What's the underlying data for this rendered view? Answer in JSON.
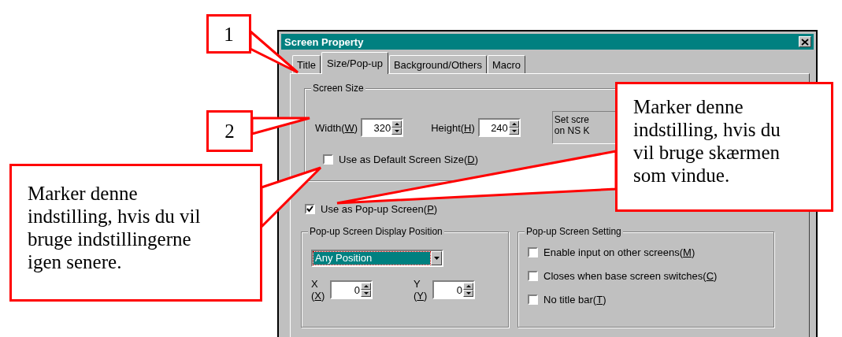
{
  "dialog": {
    "title": "Screen Property"
  },
  "tabs": [
    {
      "label": "Title",
      "selected": false
    },
    {
      "label": "Size/Pop-up",
      "selected": true
    },
    {
      "label": "Background/Others",
      "selected": false
    },
    {
      "label": "Macro",
      "selected": false
    }
  ],
  "screen_size": {
    "title": "Screen Size",
    "width": {
      "label": [
        "Width(",
        "W",
        ")"
      ],
      "value": "320"
    },
    "height": {
      "label": [
        "Height(",
        "H",
        ")"
      ],
      "value": "240"
    },
    "info_lines": [
      "Set scre",
      "on NS K"
    ],
    "default_size": {
      "label": [
        "Use as Default Screen Size(",
        "D",
        ")"
      ],
      "checked": false
    }
  },
  "popup_screen": {
    "label": [
      "Use as Pop-up Screen(",
      "P",
      ")"
    ],
    "checked": true
  },
  "display_position": {
    "title": "Pop-up Screen Display Position",
    "dropdown": "Any Position",
    "x": {
      "line1": "X",
      "line2": [
        "(",
        "X",
        ")"
      ],
      "value": "0"
    },
    "y": {
      "line1": "Y",
      "line2": [
        "(",
        "Y",
        ")"
      ],
      "value": "0"
    }
  },
  "popup_setting": {
    "title": "Pop-up Screen Setting",
    "options": [
      {
        "label": [
          "Enable input on other screens(",
          "M",
          ")"
        ],
        "checked": false
      },
      {
        "label": [
          "Closes when base screen switches(",
          "C",
          ")"
        ],
        "checked": false
      },
      {
        "label": [
          "No title bar(",
          "T",
          ")"
        ],
        "checked": false
      }
    ]
  },
  "callouts": [
    {
      "lines": [
        "1"
      ]
    },
    {
      "lines": [
        "2"
      ]
    },
    {
      "lines": [
        "Marker denne",
        "indstilling, hvis du vil",
        "bruge indstillingerne",
        "igen senere."
      ]
    },
    {
      "lines": [
        "Marker denne",
        "indstilling, hvis du",
        "vil bruge skærmen",
        "som vindue."
      ]
    }
  ]
}
